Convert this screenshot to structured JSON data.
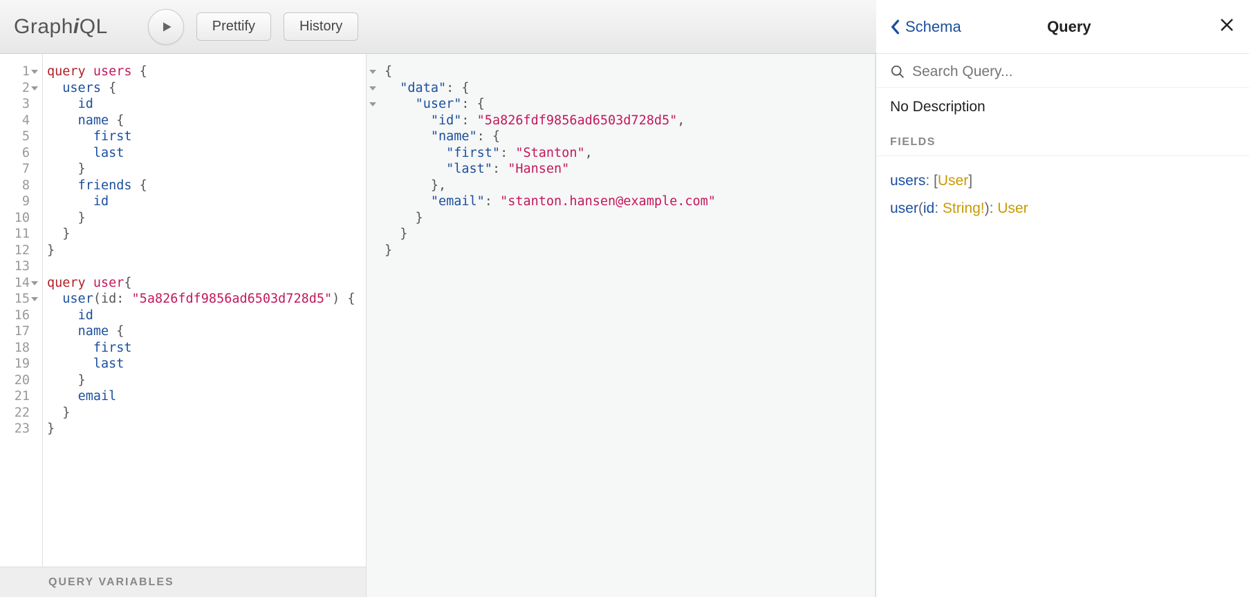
{
  "logo_text": "GraphiQL",
  "toolbar": {
    "prettify": "Prettify",
    "history": "History"
  },
  "editor": {
    "lines": [
      {
        "n": "1",
        "fold": true,
        "tokens": [
          [
            "kw",
            "query "
          ],
          [
            "def",
            "users"
          ],
          [
            "",
            ""
          ],
          [
            "",
            " {"
          ]
        ]
      },
      {
        "n": "2",
        "fold": true,
        "tokens": [
          [
            "",
            "  "
          ],
          [
            "fld",
            "users"
          ],
          [
            "",
            " {"
          ]
        ]
      },
      {
        "n": "3",
        "tokens": [
          [
            "",
            "    "
          ],
          [
            "fld",
            "id"
          ]
        ]
      },
      {
        "n": "4",
        "tokens": [
          [
            "",
            "    "
          ],
          [
            "fld",
            "name"
          ],
          [
            "",
            " {"
          ]
        ]
      },
      {
        "n": "5",
        "tokens": [
          [
            "",
            "      "
          ],
          [
            "fld",
            "first"
          ]
        ]
      },
      {
        "n": "6",
        "tokens": [
          [
            "",
            "      "
          ],
          [
            "fld",
            "last"
          ]
        ]
      },
      {
        "n": "7",
        "tokens": [
          [
            "",
            "    }"
          ]
        ]
      },
      {
        "n": "8",
        "tokens": [
          [
            "",
            "    "
          ],
          [
            "fld",
            "friends"
          ],
          [
            "",
            " {"
          ]
        ]
      },
      {
        "n": "9",
        "tokens": [
          [
            "",
            "      "
          ],
          [
            "fld",
            "id"
          ]
        ]
      },
      {
        "n": "10",
        "tokens": [
          [
            "",
            "    }"
          ]
        ]
      },
      {
        "n": "11",
        "tokens": [
          [
            "",
            "  }"
          ]
        ]
      },
      {
        "n": "12",
        "tokens": [
          [
            "",
            "}"
          ]
        ]
      },
      {
        "n": "13",
        "tokens": [
          [
            "",
            ""
          ]
        ]
      },
      {
        "n": "14",
        "fold": true,
        "tokens": [
          [
            "kw",
            "query "
          ],
          [
            "def",
            "user"
          ],
          [
            "",
            "{"
          ]
        ]
      },
      {
        "n": "15",
        "fold": true,
        "tokens": [
          [
            "",
            "  "
          ],
          [
            "fld",
            "user"
          ],
          [
            "",
            "("
          ],
          [
            "attr",
            "id"
          ],
          [
            "",
            ": "
          ],
          [
            "str",
            "\"5a826fdf9856ad6503d728d5\""
          ],
          [
            "",
            ") {"
          ]
        ]
      },
      {
        "n": "16",
        "tokens": [
          [
            "",
            "    "
          ],
          [
            "fld",
            "id"
          ]
        ]
      },
      {
        "n": "17",
        "tokens": [
          [
            "",
            "    "
          ],
          [
            "fld",
            "name"
          ],
          [
            "",
            " {"
          ]
        ]
      },
      {
        "n": "18",
        "tokens": [
          [
            "",
            "      "
          ],
          [
            "fld",
            "first"
          ]
        ]
      },
      {
        "n": "19",
        "tokens": [
          [
            "",
            "      "
          ],
          [
            "fld",
            "last"
          ]
        ]
      },
      {
        "n": "20",
        "tokens": [
          [
            "",
            "    }"
          ]
        ]
      },
      {
        "n": "21",
        "tokens": [
          [
            "",
            "    "
          ],
          [
            "fld",
            "email"
          ]
        ]
      },
      {
        "n": "22",
        "tokens": [
          [
            "",
            "  }"
          ]
        ]
      },
      {
        "n": "23",
        "tokens": [
          [
            "",
            "}"
          ]
        ]
      }
    ]
  },
  "query_variables_label": "QUERY VARIABLES",
  "result": {
    "lines": [
      {
        "fold": true,
        "tokens": [
          [
            "",
            "{"
          ]
        ]
      },
      {
        "fold": true,
        "tokens": [
          [
            "",
            "  "
          ],
          [
            "jkey",
            "\"data\""
          ],
          [
            "",
            ": {"
          ]
        ]
      },
      {
        "fold": true,
        "tokens": [
          [
            "",
            "    "
          ],
          [
            "jkey",
            "\"user\""
          ],
          [
            "",
            ": {"
          ]
        ]
      },
      {
        "tokens": [
          [
            "",
            "      "
          ],
          [
            "jkey",
            "\"id\""
          ],
          [
            "",
            ": "
          ],
          [
            "jstr",
            "\"5a826fdf9856ad6503d728d5\""
          ],
          [
            "",
            ","
          ]
        ]
      },
      {
        "tokens": [
          [
            "",
            "      "
          ],
          [
            "jkey",
            "\"name\""
          ],
          [
            "",
            ": {"
          ]
        ]
      },
      {
        "tokens": [
          [
            "",
            "        "
          ],
          [
            "jkey",
            "\"first\""
          ],
          [
            "",
            ": "
          ],
          [
            "jstr",
            "\"Stanton\""
          ],
          [
            "",
            ","
          ]
        ]
      },
      {
        "tokens": [
          [
            "",
            "        "
          ],
          [
            "jkey",
            "\"last\""
          ],
          [
            "",
            ": "
          ],
          [
            "jstr",
            "\"Hansen\""
          ]
        ]
      },
      {
        "tokens": [
          [
            "",
            "      },"
          ]
        ]
      },
      {
        "tokens": [
          [
            "",
            "      "
          ],
          [
            "jkey",
            "\"email\""
          ],
          [
            "",
            ": "
          ],
          [
            "jstr",
            "\"stanton.hansen@example.com\""
          ]
        ]
      },
      {
        "tokens": [
          [
            "",
            "    }"
          ]
        ]
      },
      {
        "tokens": [
          [
            "",
            "  }"
          ]
        ]
      },
      {
        "tokens": [
          [
            "",
            "}"
          ]
        ]
      }
    ]
  },
  "docs": {
    "back_label": "Schema",
    "title": "Query",
    "search_placeholder": "Search Query...",
    "description": "No Description",
    "fields_label": "FIELDS",
    "fields": [
      {
        "name": "users",
        "args": [],
        "ret_pre": "[",
        "ret": "User",
        "ret_post": "]"
      },
      {
        "name": "user",
        "args": [
          {
            "name": "id",
            "type": "String!"
          }
        ],
        "ret_pre": "",
        "ret": "User",
        "ret_post": ""
      }
    ]
  }
}
